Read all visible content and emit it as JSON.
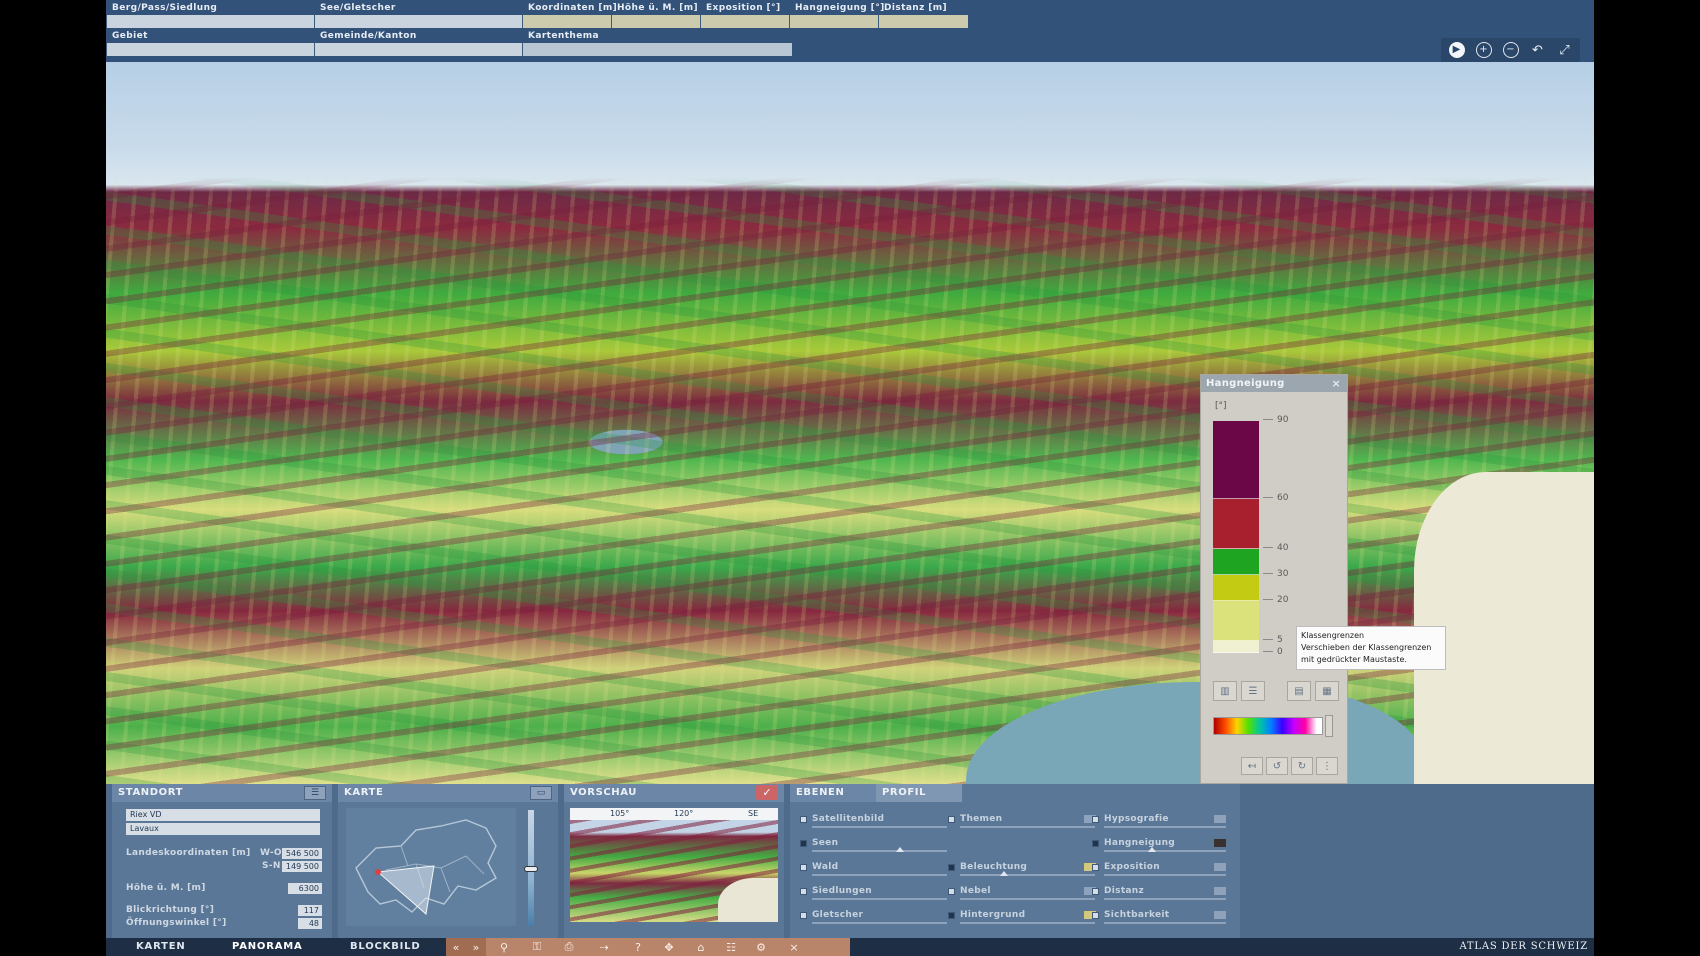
{
  "topbar": {
    "fields": [
      {
        "label": "Berg/Pass/Siedlung",
        "value": ""
      },
      {
        "label": "See/Gletscher",
        "value": ""
      },
      {
        "label": "Koordinaten [m]",
        "value": ""
      },
      {
        "label": "Höhe ü. M. [m]",
        "value": ""
      },
      {
        "label": "Exposition [°]",
        "value": ""
      },
      {
        "label": "Hangneigung [°]",
        "value": ""
      },
      {
        "label": "Distanz [m]",
        "value": ""
      },
      {
        "label": "Gebiet",
        "value": ""
      },
      {
        "label": "Gemeinde/Kanton",
        "value": ""
      },
      {
        "label": "Kartenthema",
        "value": ""
      }
    ],
    "tools": {
      "play": "▶",
      "zoom_in": "+",
      "zoom_out": "−",
      "back": "↶",
      "fullscreen": "⤢"
    }
  },
  "legend": {
    "title": "Hangneigung",
    "close": "×",
    "unit": "[°]",
    "ticks": [
      "90",
      "60",
      "40",
      "30",
      "20",
      "5",
      "0"
    ],
    "classes": [
      {
        "from": 60,
        "to": 90,
        "color": "#6b0747"
      },
      {
        "from": 40,
        "to": 60,
        "color": "#a81f2e"
      },
      {
        "from": 30,
        "to": 40,
        "color": "#1ea421"
      },
      {
        "from": 20,
        "to": 30,
        "color": "#c3cb12"
      },
      {
        "from": 5,
        "to": 20,
        "color": "#dbe27c"
      },
      {
        "from": 0,
        "to": 5,
        "color": "#efefd2"
      }
    ],
    "buttons": [
      "▥",
      "☰",
      "▤",
      "▦"
    ],
    "bottom_buttons": [
      "↤",
      "↺",
      "↻",
      "⋮"
    ]
  },
  "tooltip": {
    "title": "Klassengrenzen",
    "text": "Verschieben der Klassengrenzen mit gedrückter Maustaste."
  },
  "standort": {
    "title": "STANDORT",
    "place": "Riex  VD",
    "area": "Lavaux",
    "coords_label": "Landeskoordinaten [m]",
    "wo_label": "W-O",
    "wo_value": "546 500",
    "sn_label": "S-N",
    "sn_value": "149 500",
    "height_label": "Höhe ü. M. [m]",
    "height_value": "6300",
    "direction_label": "Blickrichtung [°]",
    "direction_value": "117",
    "angle_label": "Öffnungswinkel [°]",
    "angle_value": "48"
  },
  "karte": {
    "title": "KARTE"
  },
  "vorschau": {
    "title": "VORSCHAU",
    "check": "✓",
    "deg1": "105°",
    "deg2": "120°",
    "dir": "SE"
  },
  "ebenen": {
    "tab_ebenen": "EBENEN",
    "tab_profil": "PROFIL",
    "col1": [
      "Satellitenbild",
      "Seen",
      "Wald",
      "Siedlungen",
      "Gletscher"
    ],
    "col2": [
      "Themen",
      "Beleuchtung",
      "Nebel",
      "Hintergrund"
    ],
    "col3": [
      "Hypsografie",
      "Hangneigung",
      "Exposition",
      "Distanz",
      "Sichtbarkeit"
    ]
  },
  "footer": {
    "nav": [
      "KARTEN",
      "PANORAMA",
      "BLOCKBILD"
    ],
    "tools": [
      "«",
      "»",
      "⚲",
      "⚿",
      "⎙",
      "⇢",
      "?",
      "✥",
      "⌂",
      "☷",
      "⚙",
      "×"
    ],
    "brand": "ATLAS DER SCHWEIZ"
  }
}
